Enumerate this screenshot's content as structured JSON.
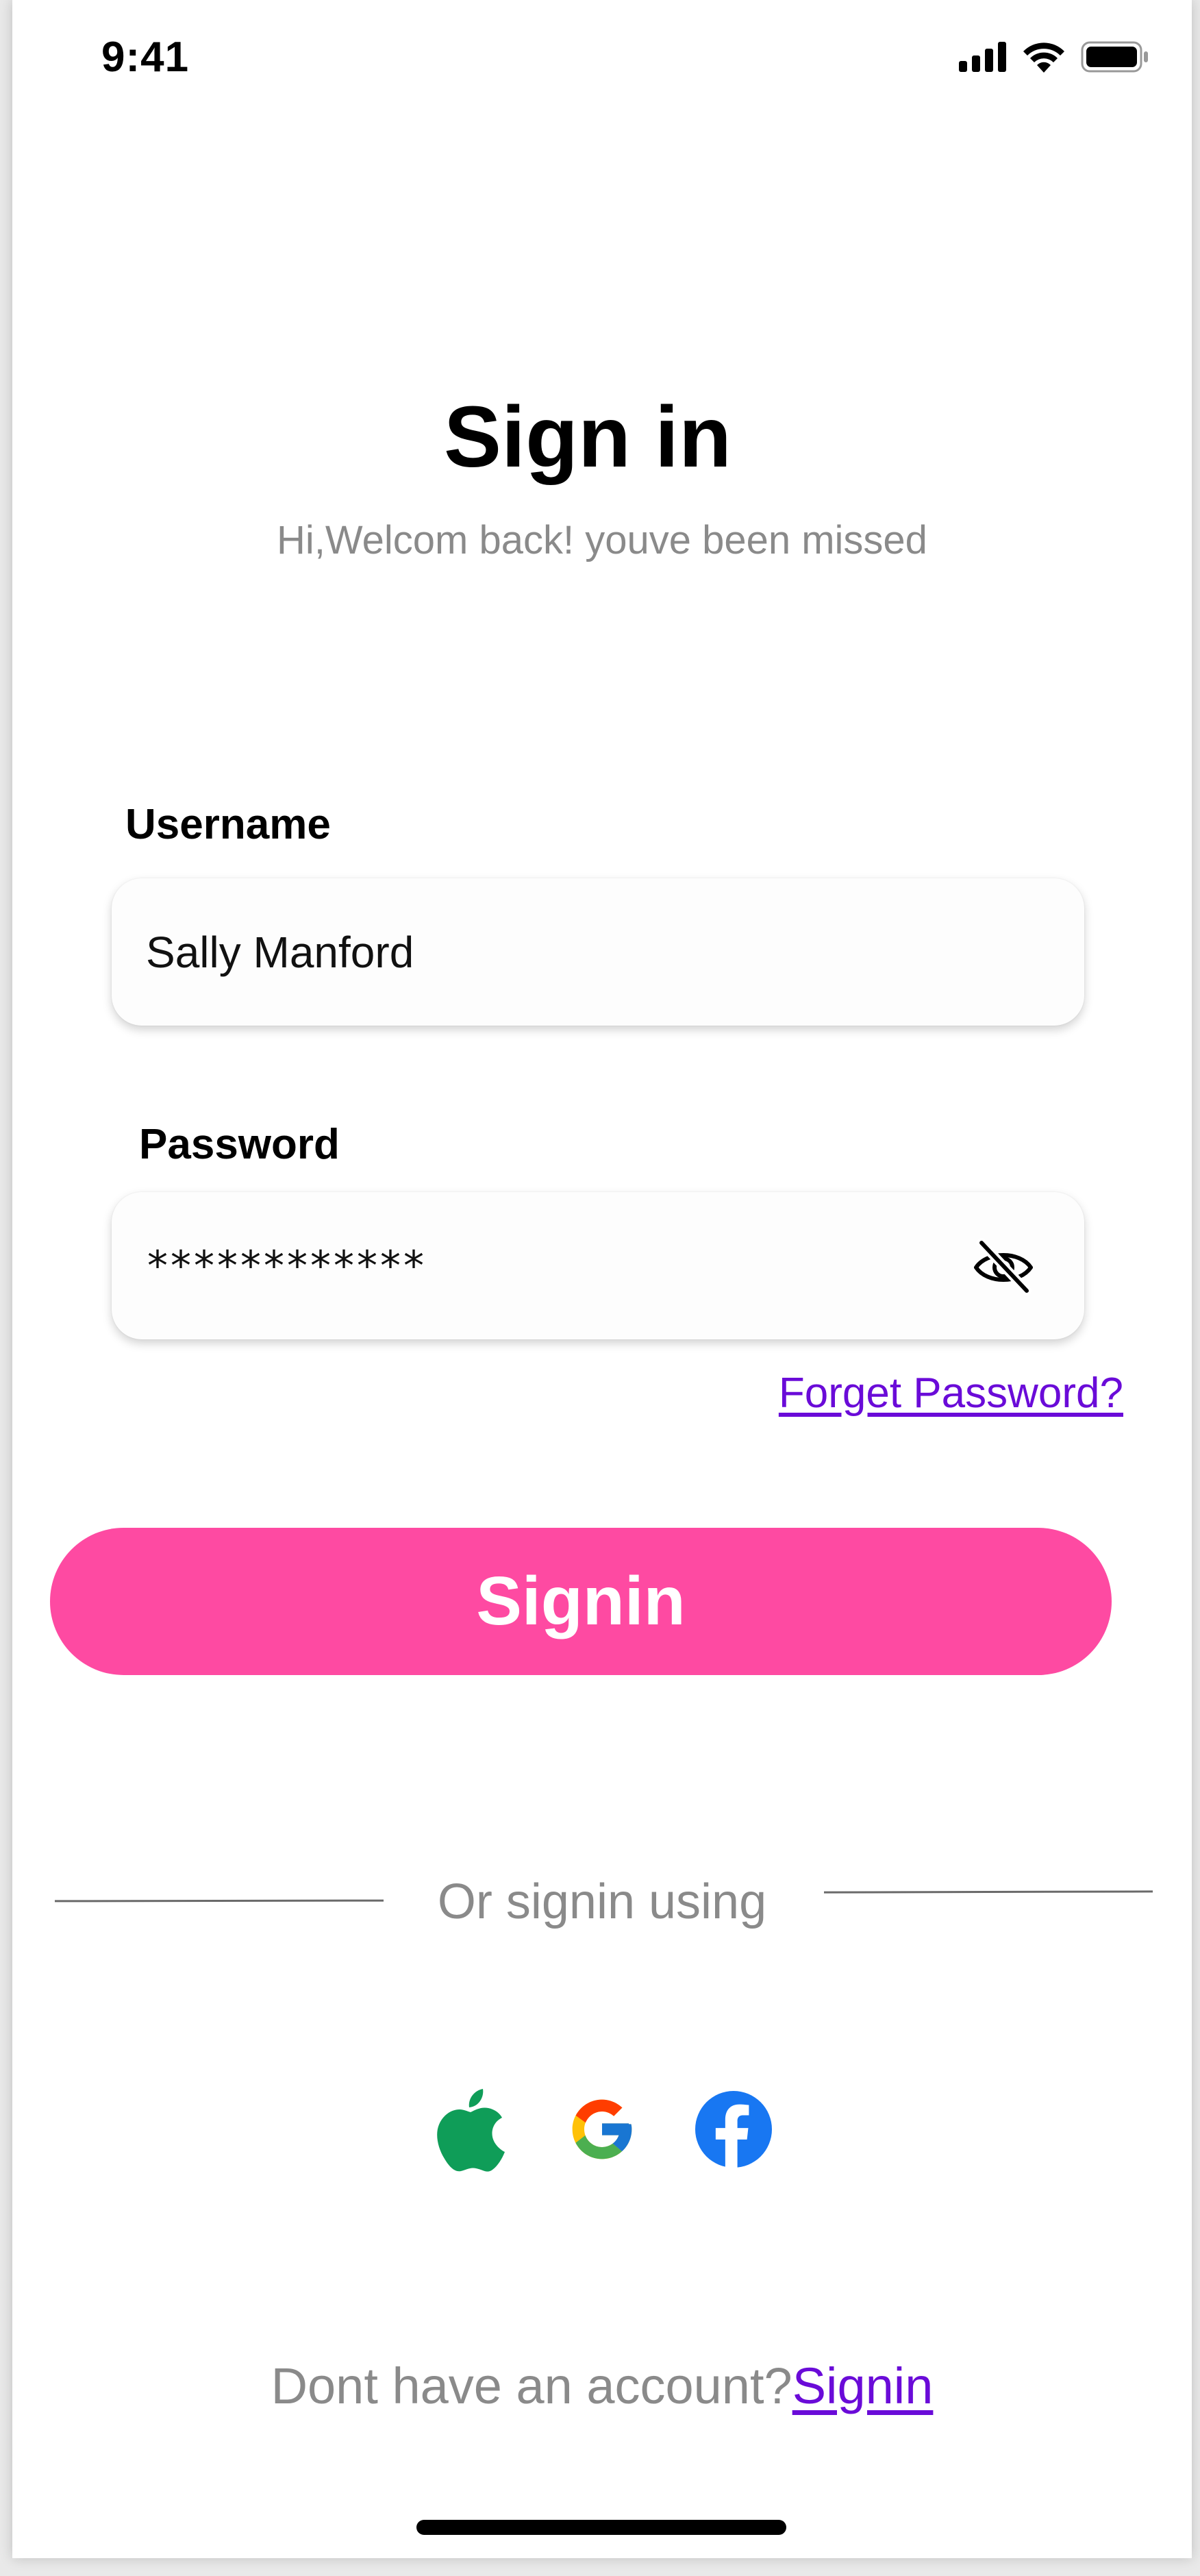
{
  "status_bar": {
    "time": "9:41",
    "icons": [
      "signal-icon",
      "wifi-icon",
      "battery-icon"
    ]
  },
  "header": {
    "title": "Sign in",
    "subtitle": "Hi,Welcom back! youve been missed"
  },
  "form": {
    "username_label": "Username",
    "username_value": "Sally Manford",
    "password_label": "Password",
    "password_value": "************",
    "password_toggle_icon": "eye-off-icon",
    "forgot_label": "Forget Password?",
    "submit_label": "Signin"
  },
  "alternate": {
    "divider_text": "Or signin using",
    "providers": [
      "apple-icon",
      "google-icon",
      "facebook-icon"
    ]
  },
  "footer": {
    "prompt": "Dont have an account?",
    "link_label": "Signin"
  },
  "colors": {
    "accent": "#fe4aa2",
    "link": "#6a0bd8",
    "muted_text": "#8a8a8a",
    "apple_green": "#0f9d58",
    "facebook_blue": "#1877f2"
  }
}
